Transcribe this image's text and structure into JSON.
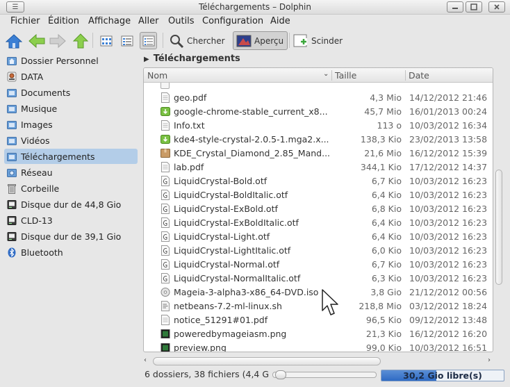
{
  "window": {
    "title": "Téléchargements – Dolphin"
  },
  "menu": [
    "Fichier",
    "Édition",
    "Affichage",
    "Aller",
    "Outils",
    "Configuration",
    "Aide"
  ],
  "toolbar": {
    "search_label": "Chercher",
    "preview_label": "Aperçu",
    "split_label": "Scinder"
  },
  "places": [
    {
      "label": "Dossier Personnel",
      "icon": "home-folder-icon"
    },
    {
      "label": "DATA",
      "icon": "drive-icon"
    },
    {
      "label": "Documents",
      "icon": "folder-icon"
    },
    {
      "label": "Musique",
      "icon": "folder-icon"
    },
    {
      "label": "Images",
      "icon": "folder-icon"
    },
    {
      "label": "Vidéos",
      "icon": "folder-icon"
    },
    {
      "label": "Téléchargements",
      "icon": "folder-icon"
    },
    {
      "label": "Réseau",
      "icon": "network-folder-icon"
    },
    {
      "label": "Corbeille",
      "icon": "trash-icon"
    },
    {
      "label": "Disque dur de 44,8 Gio",
      "icon": "harddisk-icon"
    },
    {
      "label": "CLD-13",
      "icon": "harddisk-icon"
    },
    {
      "label": "Disque dur de 39,1 Gio",
      "icon": "harddisk-icon"
    },
    {
      "label": "Bluetooth",
      "icon": "bluetooth-icon"
    }
  ],
  "breadcrumb": {
    "current": "Téléchargements"
  },
  "columns": {
    "name": "Nom",
    "size": "Taille",
    "date": "Date"
  },
  "files": [
    {
      "name": "geo.pdf",
      "size": "4,3 Mio",
      "date": "14/12/2012 21:46",
      "icon": "pdf-icon"
    },
    {
      "name": "google-chrome-stable_current_x8...",
      "size": "45,7 Mio",
      "date": "16/01/2013 00:24",
      "icon": "package-icon"
    },
    {
      "name": "Info.txt",
      "size": "113 o",
      "date": "10/03/2012 16:34",
      "icon": "text-icon"
    },
    {
      "name": "kde4-style-crystal-2.0.5-1.mga2.x...",
      "size": "138,3 Kio",
      "date": "23/02/2013 13:58",
      "icon": "package-icon"
    },
    {
      "name": "KDE_Crystal_Diamond_2.85_Mand...",
      "size": "21,6 Mio",
      "date": "16/12/2012 15:39",
      "icon": "archive-icon"
    },
    {
      "name": "lab.pdf",
      "size": "344,1 Kio",
      "date": "17/12/2012 14:37",
      "icon": "pdf-icon"
    },
    {
      "name": "LiquidCrystal-Bold.otf",
      "size": "6,7 Kio",
      "date": "10/03/2012 16:23",
      "icon": "font-icon"
    },
    {
      "name": "LiquidCrystal-BoldItalic.otf",
      "size": "6,4 Kio",
      "date": "10/03/2012 16:23",
      "icon": "font-icon"
    },
    {
      "name": "LiquidCrystal-ExBold.otf",
      "size": "6,8 Kio",
      "date": "10/03/2012 16:23",
      "icon": "font-icon"
    },
    {
      "name": "LiquidCrystal-ExBoldItalic.otf",
      "size": "6,4 Kio",
      "date": "10/03/2012 16:23",
      "icon": "font-icon"
    },
    {
      "name": "LiquidCrystal-Light.otf",
      "size": "6,4 Kio",
      "date": "10/03/2012 16:23",
      "icon": "font-icon"
    },
    {
      "name": "LiquidCrystal-LightItalic.otf",
      "size": "6,0 Kio",
      "date": "10/03/2012 16:23",
      "icon": "font-icon"
    },
    {
      "name": "LiquidCrystal-Normal.otf",
      "size": "6,7 Kio",
      "date": "10/03/2012 16:23",
      "icon": "font-icon"
    },
    {
      "name": "LiquidCrystal-NormalItalic.otf",
      "size": "6,3 Kio",
      "date": "10/03/2012 16:23",
      "icon": "font-icon"
    },
    {
      "name": "Mageia-3-alpha3-x86_64-DVD.iso",
      "size": "3,8 Gio",
      "date": "21/12/2012 00:56",
      "icon": "disc-image-icon"
    },
    {
      "name": "netbeans-7.2-ml-linux.sh",
      "size": "218,8 Mio",
      "date": "03/12/2012 18:24",
      "icon": "script-icon"
    },
    {
      "name": "notice_51291#01.pdf",
      "size": "96,5 Kio",
      "date": "09/12/2012 13:48",
      "icon": "pdf-icon"
    },
    {
      "name": "poweredbymageiasm.png",
      "size": "21,3 Kio",
      "date": "16/12/2012 16:20",
      "icon": "image-icon"
    },
    {
      "name": "preview.png",
      "size": "99,0 Kio",
      "date": "10/03/2012 16:51",
      "icon": "image-icon"
    }
  ],
  "status": {
    "text": "6 dossiers, 38 fichiers (4,4 G",
    "free_space": "30,2 Gio libre(s)",
    "used_fraction": 0.45
  },
  "colors": {
    "selection": "#b3cde8",
    "accent": "#2f6bc4",
    "go_arrows": "#6fb33a",
    "home": "#3b7fd4"
  }
}
